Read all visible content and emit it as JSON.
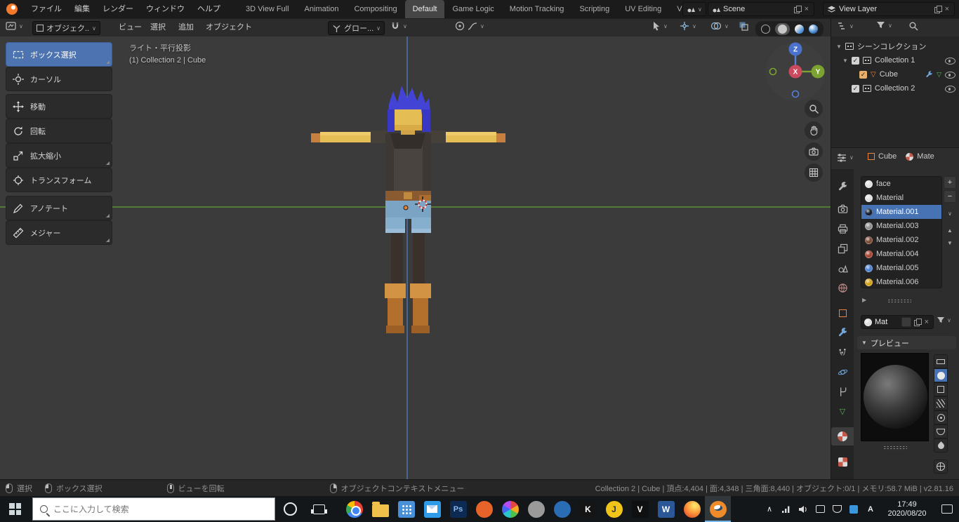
{
  "icons": {
    "caret": "∨",
    "tri_down": "▼",
    "tri_right": "▶",
    "tri_up": "▲",
    "plus": "+",
    "minus": "−",
    "close": "×",
    "check": "✓",
    "chevron_up": "∧"
  },
  "menubar": {
    "menus": [
      "ファイル",
      "編集",
      "レンダー",
      "ウィンドウ",
      "ヘルプ"
    ],
    "workspaces": [
      "3D View Full",
      "Animation",
      "Compositing",
      "Default",
      "Game Logic",
      "Motion Tracking",
      "Scripting",
      "UV Editing",
      "Video"
    ],
    "active_workspace": "Default",
    "scene_name": "Scene",
    "view_layer_name": "View Layer"
  },
  "header": {
    "mode": "オブジェク..",
    "menu_view": "ビュー",
    "menu_select": "選択",
    "menu_add": "追加",
    "menu_object": "オブジェクト",
    "orientation": "グロー..."
  },
  "toolshelf": [
    {
      "label": "ボックス選択",
      "active": true
    },
    {
      "label": "カーソル"
    },
    {
      "label": "移動"
    },
    {
      "label": "回転"
    },
    {
      "label": "拡大縮小"
    },
    {
      "label": "トランスフォーム"
    },
    {
      "label": "アノテート"
    },
    {
      "label": "メジャー"
    }
  ],
  "viewport": {
    "view_label": "ライト・平行投影",
    "collection_label": "(1) Collection 2 | Cube",
    "axis_x": "X",
    "axis_y": "Y",
    "axis_z": "Z"
  },
  "outliner": {
    "scene_collection": "シーンコレクション",
    "collection1": "Collection 1",
    "cube": "Cube",
    "collection2": "Collection 2"
  },
  "properties": {
    "object_name": "Cube",
    "material_tab": "Mate",
    "slots": [
      {
        "name": "face",
        "color": "#e0e0e0"
      },
      {
        "name": "Material",
        "color": "#e0e0e0"
      },
      {
        "name": "Material.001",
        "color": "#141e32",
        "selected": true
      },
      {
        "name": "Material.003",
        "color": "#8f8f8f"
      },
      {
        "name": "Material.002",
        "color": "#7d4b38"
      },
      {
        "name": "Material.004",
        "color": "#a84432"
      },
      {
        "name": "Material.005",
        "color": "#4f83d2"
      },
      {
        "name": "Material.006",
        "color": "#d2a21c"
      }
    ],
    "material_name": "Mat",
    "preview_label": "プレビュー"
  },
  "statusbar": {
    "select": "選択",
    "box_select": "ボックス選択",
    "rotate_view": "ビューを回転",
    "context_menu": "オブジェクトコンテキストメニュー",
    "stats": "Collection 2 | Cube | 頂点:4,404 | 面:4,348 | 三角面:8,440 | オブジェクト:0/1 | メモリ:58.7 MiB | v2.81.16"
  },
  "taskbar": {
    "search_placeholder": "ここに入力して検索",
    "apps": [
      {
        "id": "chrome"
      },
      {
        "id": "explorer"
      },
      {
        "id": "apps-grid",
        "color": "#4a90d9"
      },
      {
        "id": "mail",
        "color": "#2f9be8"
      },
      {
        "id": "photoshop",
        "letter": "Ps",
        "color": "#0d2b52"
      },
      {
        "id": "orange-app",
        "color": "#e8632a"
      },
      {
        "id": "pinwheel"
      },
      {
        "id": "gray-app",
        "color": "#9a9a9a"
      },
      {
        "id": "blue-app",
        "color": "#2a6db5"
      },
      {
        "id": "k-app",
        "letter": "K",
        "color": "#151515"
      },
      {
        "id": "j-app",
        "letter": "J",
        "color": "#f0c419"
      },
      {
        "id": "v-app",
        "letter": "V",
        "color": "#101010"
      },
      {
        "id": "word",
        "letter": "W",
        "color": "#2b5797"
      },
      {
        "id": "firefox",
        "color": "#ff7139"
      },
      {
        "id": "blender",
        "active": true
      }
    ],
    "ime": "A",
    "time": "17:49",
    "date": "2020/08/20"
  }
}
